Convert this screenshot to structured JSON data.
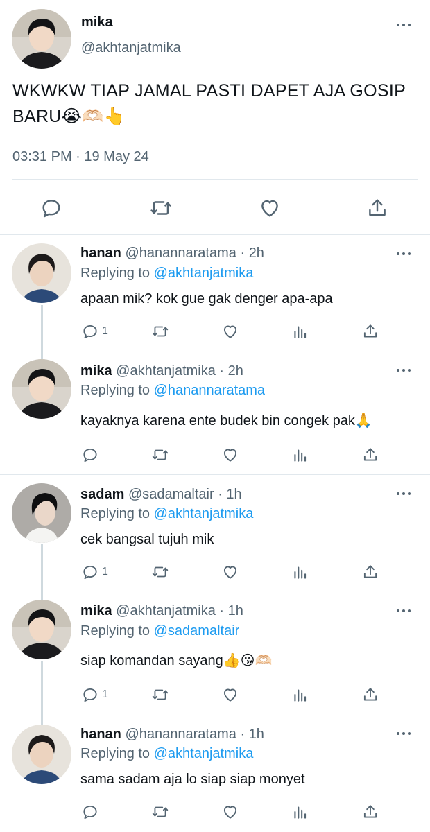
{
  "main_tweet": {
    "name": "mika",
    "handle": "@akhtanjatmika",
    "text": "WKWKW TIAP JAMAL PASTI DAPET AJA GOSIP BARU😭🫶🏻👆",
    "timestamp": "03:31 PM · 19 May 24",
    "actions": [
      "reply-icon",
      "retweet-icon",
      "like-icon",
      "share-icon"
    ]
  },
  "replies": [
    {
      "name": "hanan",
      "handle": "@hanannaratama",
      "sep": "·",
      "time": "2h",
      "replying_prefix": "Replying to",
      "replying_to": "@akhtanjatmika",
      "text": "apaan mik? kok gue gak denger apa-apa",
      "reply_count": "1"
    },
    {
      "name": "mika",
      "handle": "@akhtanjatmika",
      "sep": "·",
      "time": "2h",
      "replying_prefix": "Replying to",
      "replying_to": "@hanannaratama",
      "text": "kayaknya karena ente budek bin congek pak🙏",
      "reply_count": ""
    },
    {
      "name": "sadam",
      "handle": "@sadamaltair",
      "sep": "·",
      "time": "1h",
      "replying_prefix": "Replying to",
      "replying_to": "@akhtanjatmika",
      "text": "cek bangsal tujuh mik",
      "reply_count": "1"
    },
    {
      "name": "mika",
      "handle": "@akhtanjatmika",
      "sep": "·",
      "time": "1h",
      "replying_prefix": "Replying to",
      "replying_to": "@sadamaltair",
      "text": "siap komandan sayang👍😘🫶🏻",
      "reply_count": "1"
    },
    {
      "name": "hanan",
      "handle": "@hanannaratama",
      "sep": "·",
      "time": "1h",
      "replying_prefix": "Replying to",
      "replying_to": "@akhtanjatmika",
      "text": "sama sadam aja lo siap siap monyet",
      "reply_count": ""
    }
  ],
  "colors": {
    "text": "#0f1419",
    "secondary": "#536471",
    "mention": "#1d9bf0",
    "divider": "#e1e8ed",
    "thread_line": "#cfd9de"
  }
}
